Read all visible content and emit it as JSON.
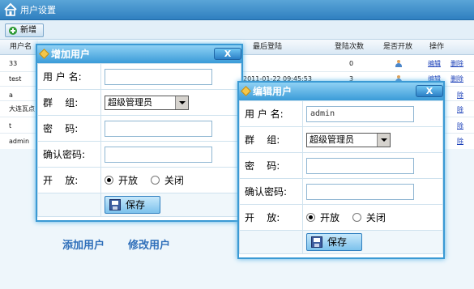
{
  "app": {
    "title": "用户设置"
  },
  "toolbar": {
    "add_label": "新增"
  },
  "grid": {
    "headers": [
      "用户名",
      "最后登陆",
      "登陆次数",
      "是否开放",
      "操作"
    ],
    "rows": [
      {
        "user": "33",
        "last": "",
        "count": "0",
        "edit": "编辑",
        "del": "删除"
      },
      {
        "user": "test",
        "last": "2011-01-22 09:45:53",
        "count": "3",
        "edit": "编辑",
        "del": "删除"
      },
      {
        "user": "a",
        "last": "",
        "count": "",
        "edit": "",
        "del": "除"
      },
      {
        "user": "大连瓦点",
        "last": "",
        "count": "",
        "edit": "",
        "del": "除"
      },
      {
        "user": "t",
        "last": "",
        "count": "",
        "edit": "",
        "del": "除"
      },
      {
        "user": "admin",
        "last": "",
        "count": "",
        "edit": "",
        "del": "除"
      }
    ]
  },
  "captions": {
    "add": "添加用户",
    "edit": "修改用户"
  },
  "add_dialog": {
    "title": "增加用户",
    "close": "X",
    "labels": {
      "user": "用 户 名:",
      "group": "群    组:",
      "pwd": "密    码:",
      "confirm": "确认密码:",
      "open": "开    放:"
    },
    "values": {
      "user": "",
      "group": "超级管理员",
      "pwd": "",
      "confirm": ""
    },
    "radio": {
      "on": "开放",
      "off": "关闭"
    },
    "save": "保存"
  },
  "edit_dialog": {
    "title": "编辑用户",
    "close": "X",
    "labels": {
      "user": "用 户 名:",
      "group": "群    组:",
      "pwd": "密    码:",
      "confirm": "确认密码:",
      "open": "开    放:"
    },
    "values": {
      "user": "admin",
      "group": "超级管理员",
      "pwd": "",
      "confirm": ""
    },
    "radio": {
      "on": "开放",
      "off": "关闭"
    },
    "save": "保存"
  }
}
